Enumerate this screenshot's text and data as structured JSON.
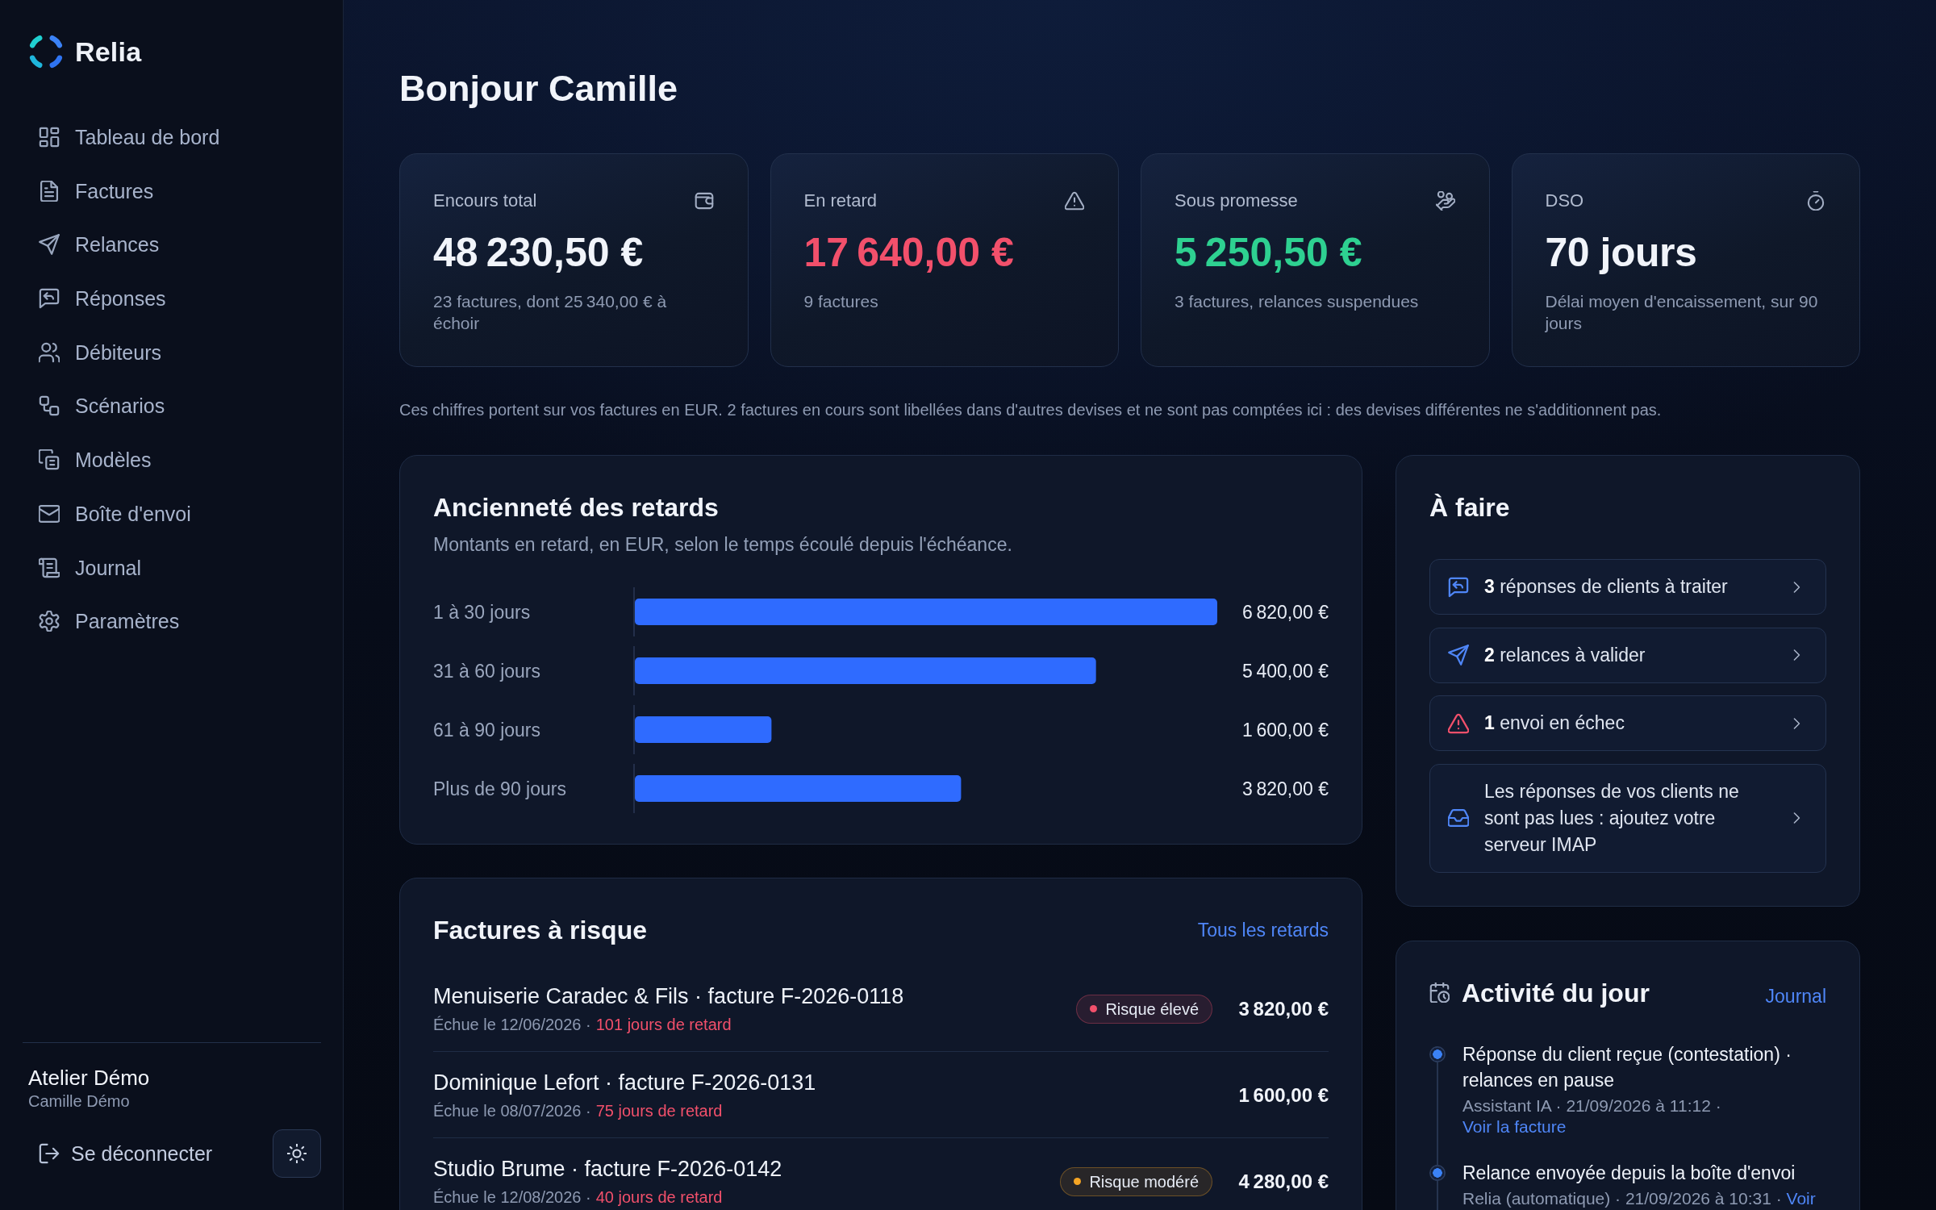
{
  "sidebar": {
    "brand": "Relia",
    "nav": [
      "Tableau de bord",
      "Factures",
      "Relances",
      "Réponses",
      "Débiteurs",
      "Scénarios",
      "Modèles",
      "Boîte d'envoi",
      "Journal",
      "Paramètres"
    ],
    "account": {
      "company": "Atelier Démo",
      "user": "Camille Démo"
    },
    "logout": "Se déconnecter"
  },
  "greeting": "Bonjour Camille",
  "kpis": [
    {
      "label": "Encours total",
      "value": "48 230,50 €",
      "color": "#f1f4fa",
      "detail": "23 factures, dont 25 340,00 € à échoir"
    },
    {
      "label": "En retard",
      "value": "17 640,00 €",
      "color": "#f2506b",
      "detail": "9 factures"
    },
    {
      "label": "Sous promesse",
      "value": "5 250,50 €",
      "color": "#2ed191",
      "detail": "3 factures, relances suspendues"
    },
    {
      "label": "DSO",
      "value": "70 jours",
      "color": "#f1f4fa",
      "detail": "Délai moyen d'encaissement, sur 90 jours"
    }
  ],
  "currency_note": "Ces chiffres portent sur vos factures en EUR. 2 factures en cours sont libellées dans d'autres devises et ne sont pas comptées ici : des devises différentes ne s'additionnent pas.",
  "aging": {
    "title": "Ancienneté des retards",
    "subtitle": "Montants en retard, en EUR, selon le temps écoulé depuis l'échéance.",
    "chart_data": {
      "type": "bar",
      "orientation": "horizontal",
      "grid": true,
      "categories": [
        "1 à 30 jours",
        "31 à 60 jours",
        "61 à 90 jours",
        "Plus de 90 jours"
      ],
      "values": [
        6820,
        5400,
        1600,
        3820
      ],
      "value_labels": [
        "6 820,00 €",
        "5 400,00 €",
        "1 600,00 €",
        "3 820,00 €"
      ]
    }
  },
  "todo": {
    "title": "À faire",
    "items": [
      {
        "text": "**3** réponses de clients à traiter",
        "color": "#4f86f7"
      },
      {
        "text": "**2** relances à valider",
        "color": "#4f86f7"
      },
      {
        "text": "**1** envoi en échec",
        "color": "#f2506b"
      },
      {
        "text": "Les réponses de vos clients ne sont pas lues : ajoutez votre serveur IMAP",
        "color": "#4f86f7"
      }
    ]
  },
  "risky_invoices": {
    "title": "Factures à risque",
    "link": "Tous les retards",
    "rows": [
      {
        "title": "Menuiserie Caradec & Fils · facture F-2026-0118",
        "due": "Échue le 12/06/2026 ·",
        "overdue": "101 jours de retard",
        "badge": {
          "label": "Risque élevé",
          "color": "#f2506b"
        },
        "amount": "3 820,00 €"
      },
      {
        "title": "Dominique Lefort · facture F-2026-0131",
        "due": "Échue le 08/07/2026 ·",
        "overdue": "75 jours de retard",
        "amount": "1 600,00 €"
      },
      {
        "title": "Studio Brume · facture F-2026-0142",
        "due": "Échue le 12/08/2026 ·",
        "overdue": "40 jours de retard",
        "badge": {
          "label": "Risque modéré",
          "color": "#f5a524"
        },
        "amount": "4 280,00 €"
      }
    ]
  },
  "activity": {
    "title": "Activité du jour",
    "link": "Journal",
    "items": [
      {
        "text": "Réponse du client reçue (contestation) · relances en pause",
        "meta": "Assistant IA · 21/09/2026 à 11:12 ·",
        "link": "Voir la facture"
      },
      {
        "text": "Relance envoyée depuis la boîte d'envoi",
        "meta": "Relia (automatique) · 21/09/2026 à 10:31 ·",
        "link": "Voir"
      }
    ]
  }
}
